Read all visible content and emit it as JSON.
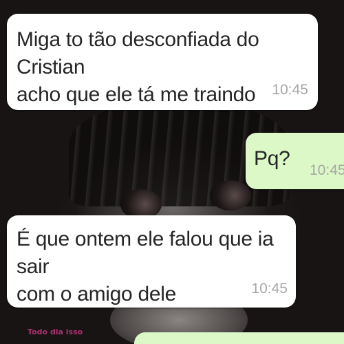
{
  "colors": {
    "incoming_bubble": "#ffffff",
    "outgoing_bubble": "#dcf8c6",
    "timestamp": "#a7a7a7",
    "watermark": "#c0357e"
  },
  "messages": [
    {
      "direction": "incoming",
      "text": "Miga to tão desconfiada do Cristian\nacho que ele tá me traindo",
      "time": "10:45"
    },
    {
      "direction": "outgoing",
      "text": "Pq?",
      "time": "10:45"
    },
    {
      "direction": "incoming",
      "text": "É que ontem ele falou que ia sair\ncom o amigo dele",
      "time": "10:45"
    },
    {
      "direction": "outgoing",
      "text": "",
      "time": ""
    }
  ],
  "watermark": "Todo dia isso"
}
